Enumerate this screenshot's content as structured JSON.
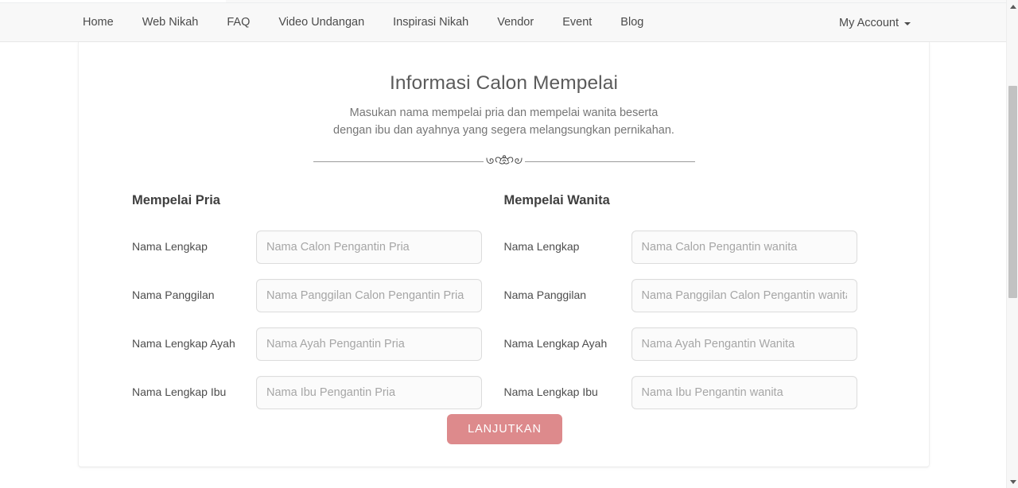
{
  "navbar": {
    "items": [
      {
        "label": "Home",
        "name": "nav-home"
      },
      {
        "label": "Web Nikah",
        "name": "nav-web-nikah"
      },
      {
        "label": "FAQ",
        "name": "nav-faq"
      },
      {
        "label": "Video Undangan",
        "name": "nav-video-undangan"
      },
      {
        "label": "Inspirasi Nikah",
        "name": "nav-inspirasi-nikah"
      },
      {
        "label": "Vendor",
        "name": "nav-vendor"
      },
      {
        "label": "Event",
        "name": "nav-event"
      },
      {
        "label": "Blog",
        "name": "nav-blog"
      }
    ],
    "account_label": "My Account",
    "caret_icon": "chevron-down-icon"
  },
  "page": {
    "title": "Informasi Calon Mempelai",
    "subtitle_line1": "Masukan nama mempelai pria dan mempelai wanita beserta",
    "subtitle_line2": "dengan ibu dan ayahnya yang segera melangsungkan pernikahan.",
    "divider_ornament": "floral-flourish-icon"
  },
  "form": {
    "groom": {
      "heading": "Mempelai Pria",
      "fields": [
        {
          "label": "Nama Lengkap",
          "placeholder": "Nama Calon Pengantin Pria",
          "value": "",
          "name": "groom-full-name"
        },
        {
          "label": "Nama Panggilan",
          "placeholder": "Nama Panggilan Calon Pengantin Pria",
          "value": "",
          "name": "groom-nickname"
        },
        {
          "label": "Nama Lengkap Ayah",
          "placeholder": "Nama Ayah Pengantin Pria",
          "value": "",
          "name": "groom-father-name"
        },
        {
          "label": "Nama Lengkap Ibu",
          "placeholder": "Nama Ibu Pengantin Pria",
          "value": "",
          "name": "groom-mother-name"
        }
      ]
    },
    "bride": {
      "heading": "Mempelai Wanita",
      "fields": [
        {
          "label": "Nama Lengkap",
          "placeholder": "Nama Calon Pengantin wanita",
          "value": "",
          "name": "bride-full-name"
        },
        {
          "label": "Nama Panggilan",
          "placeholder": "Nama Panggilan Calon Pengantin wanita",
          "value": "",
          "name": "bride-nickname"
        },
        {
          "label": "Nama Lengkap Ayah",
          "placeholder": "Nama Ayah Pengantin Wanita",
          "value": "",
          "name": "bride-father-name"
        },
        {
          "label": "Nama Lengkap Ibu",
          "placeholder": "Nama Ibu Pengantin wanita",
          "value": "",
          "name": "bride-mother-name"
        }
      ]
    },
    "submit_label": "LANJUTKAN"
  },
  "scrollbar": {
    "up_arrow_icon": "caret-up-icon",
    "down_arrow_icon": "caret-down-icon"
  },
  "colors": {
    "navbar_bg": "#f8f8f8",
    "card_bg": "#ffffff",
    "title_text": "#5b5b5b",
    "subtitle_text": "#767676",
    "label_text": "#4d4d4d",
    "placeholder_text": "#a6a6a6",
    "input_border": "#dcdcdc",
    "input_bg": "#fbfbfb",
    "button_bg": "#dd8a8c",
    "button_text": "#ffffff",
    "divider_rule": "#9a9a9a",
    "scrollbar_thumb": "#c2c2c2"
  }
}
